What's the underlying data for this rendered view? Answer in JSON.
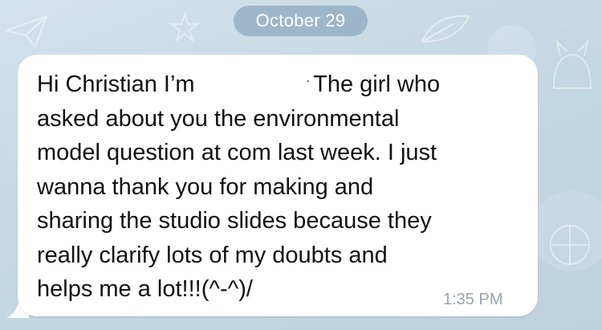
{
  "chat": {
    "date_separator": "October 29",
    "message": {
      "greeting": "Hi Christian I’m",
      "after_redaction": "The girl who",
      "lines": [
        "asked about you the environmental",
        "model question at com last week. I just",
        "wanna thank you for making and",
        "sharing the studio slides because they",
        "really clarify lots of my doubts and",
        "helps me a lot!!!(^-^)/"
      ],
      "time": "1:35 PM"
    }
  },
  "colors": {
    "background": "#c9d9e5",
    "bubble": "#ffffff",
    "date_pill": "#7896af",
    "timestamp": "#9aa3ab",
    "text": "#111111"
  }
}
